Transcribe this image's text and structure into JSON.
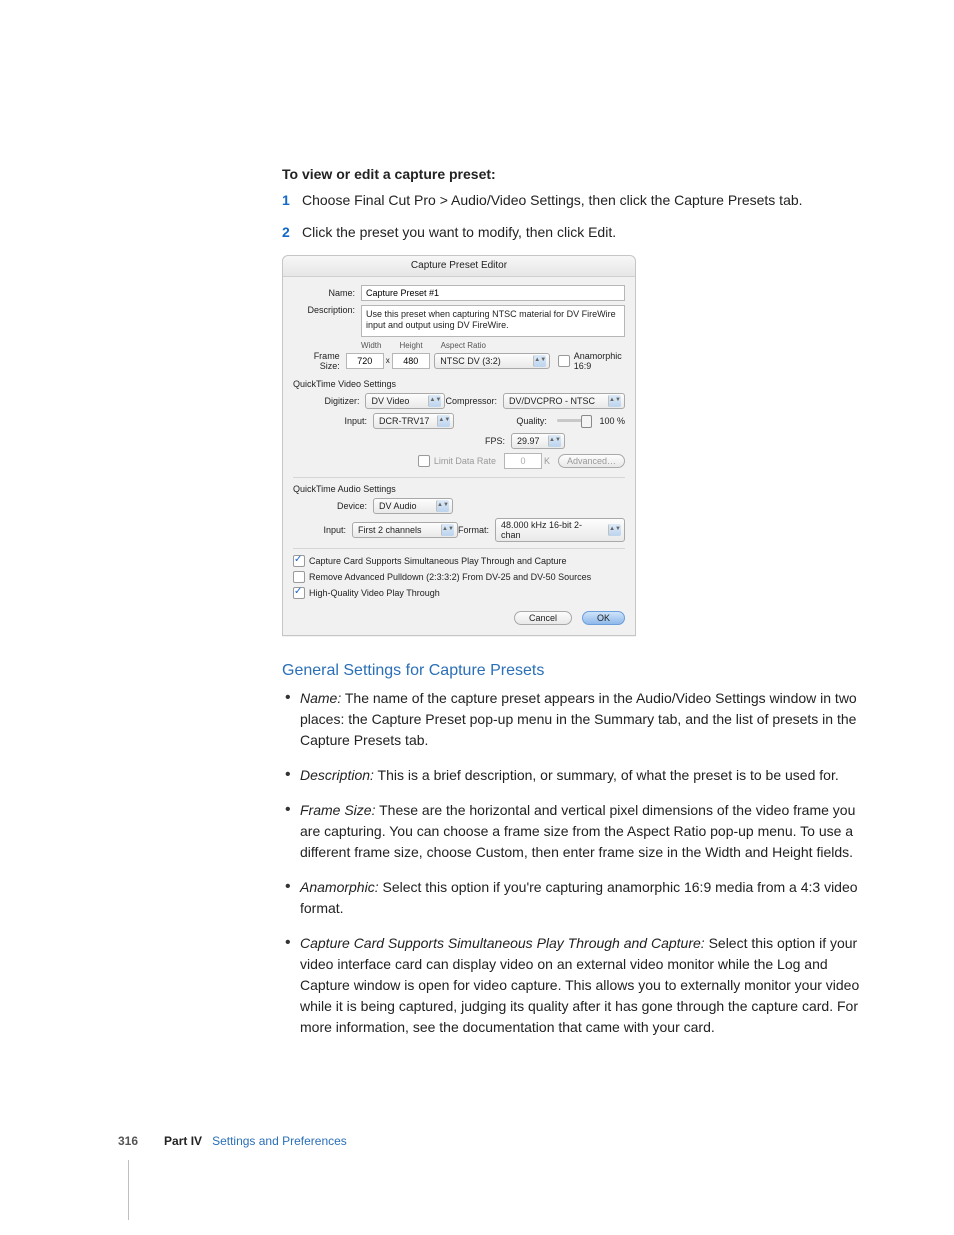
{
  "intro": {
    "heading": "To view or edit a capture preset:",
    "steps": [
      "Choose Final Cut Pro > Audio/Video Settings, then click the Capture Presets tab.",
      "Click the preset you want to modify, then click Edit."
    ]
  },
  "dialog": {
    "title": "Capture Preset Editor",
    "name_label": "Name:",
    "name_value": "Capture Preset #1",
    "desc_label": "Description:",
    "desc_value": "Use this preset when capturing NTSC material for DV FireWire input and output using DV FireWire.",
    "framesize_label": "Frame Size:",
    "width_value": "720",
    "height_value": "480",
    "col_width": "Width",
    "col_height": "Height",
    "col_aspect": "Aspect Ratio",
    "aspect_popup": "NTSC DV (3:2)",
    "anamorphic_label": "Anamorphic 16:9",
    "qtv_header": "QuickTime Video Settings",
    "digitizer_label": "Digitizer:",
    "digitizer_value": "DV Video",
    "input_label": "Input:",
    "input_value": "DCR-TRV17",
    "compressor_label": "Compressor:",
    "compressor_value": "DV/DVCPRO - NTSC",
    "quality_label": "Quality:",
    "quality_pct": "100 %",
    "fps_label": "FPS:",
    "fps_value": "29.97",
    "limit_label": "Limit Data Rate",
    "limit_value": "0",
    "limit_unit": "K",
    "advanced_label": "Advanced…",
    "qta_header": "QuickTime Audio Settings",
    "device_label": "Device:",
    "device_value": "DV Audio",
    "ainput_label": "Input:",
    "ainput_value": "First 2 channels",
    "format_label": "Format:",
    "format_value": "48.000 kHz 16-bit 2-chan",
    "opt1": "Capture Card Supports Simultaneous Play Through and Capture",
    "opt2": "Remove Advanced Pulldown (2:3:3:2) From DV-25 and DV-50 Sources",
    "opt3": "High-Quality Video Play Through",
    "cancel": "Cancel",
    "ok": "OK"
  },
  "section_heading": "General Settings for Capture Presets",
  "items": [
    {
      "term": "Name:",
      "text": "  The name of the capture preset appears in the Audio/Video Settings window in two places:  the Capture Preset pop-up menu in the Summary tab, and the list of presets in the Capture Presets tab."
    },
    {
      "term": "Description:",
      "text": "  This is a brief description, or summary, of what the preset is to be used for."
    },
    {
      "term": "Frame Size:",
      "text": "  These are the horizontal and vertical pixel dimensions of the video frame you are capturing. You can choose a frame size from the Aspect Ratio pop-up menu. To use a different frame size, choose Custom, then enter frame size in the Width and Height fields."
    },
    {
      "term": "Anamorphic:",
      "text": "  Select this option if you're capturing anamorphic 16:9 media from a 4:3 video format."
    },
    {
      "term": "Capture Card Supports Simultaneous Play Through and Capture:",
      "text": "  Select this option if your video interface card can display video on an external video monitor while the Log and Capture window is open for video capture. This allows you to externally monitor your video while it is being captured, judging its quality after it has gone through the capture card. For more information, see the documentation that came with your card."
    }
  ],
  "footer": {
    "page": "316",
    "part_label": "Part IV",
    "part_name": "Settings and Preferences"
  }
}
